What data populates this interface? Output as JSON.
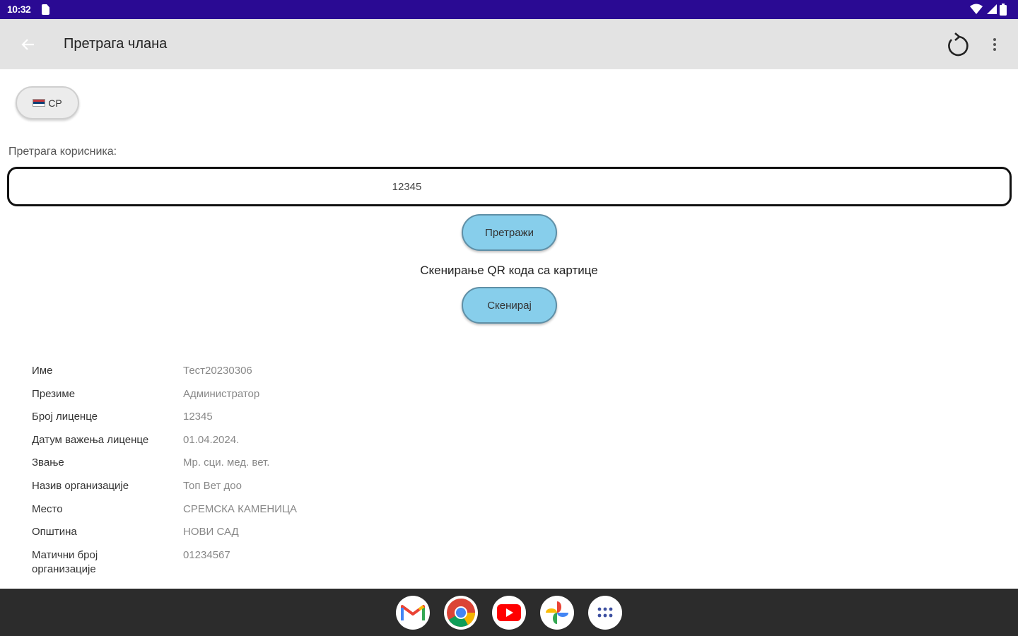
{
  "status_bar": {
    "time": "10:32"
  },
  "app_bar": {
    "title": "Претрага члана"
  },
  "language": {
    "label": "СР"
  },
  "search": {
    "label": "Претрага корисника:",
    "value": "12345",
    "button_label": "Претражи"
  },
  "scan": {
    "label": "Скенирање QR кода са картице",
    "button_label": "Скенирај"
  },
  "details": [
    {
      "key": "Име",
      "value": "Тест20230306"
    },
    {
      "key": "Презиме",
      "value": "Администратор"
    },
    {
      "key": "Број лиценце",
      "value": "12345"
    },
    {
      "key": "Датум важења лиценце",
      "value": "01.04.2024."
    },
    {
      "key": "Звање",
      "value": "Мр. сци. мед. вет."
    },
    {
      "key": "Назив организације",
      "value": "Топ Вет доо"
    },
    {
      "key": "Место",
      "value": "СРЕМСКА КАМЕНИЦА"
    },
    {
      "key": "Општина",
      "value": "НОВИ САД"
    },
    {
      "key": "Матични број организације",
      "value": "01234567"
    }
  ],
  "dock_apps": [
    "gmail-icon",
    "chrome-icon",
    "youtube-icon",
    "photos-icon",
    "app-drawer-icon"
  ],
  "colors": {
    "status_bar": "#2a0a93",
    "app_bar": "#e3e3e3",
    "button": "#87ceeb",
    "nav_bar": "#2c2c2c"
  }
}
